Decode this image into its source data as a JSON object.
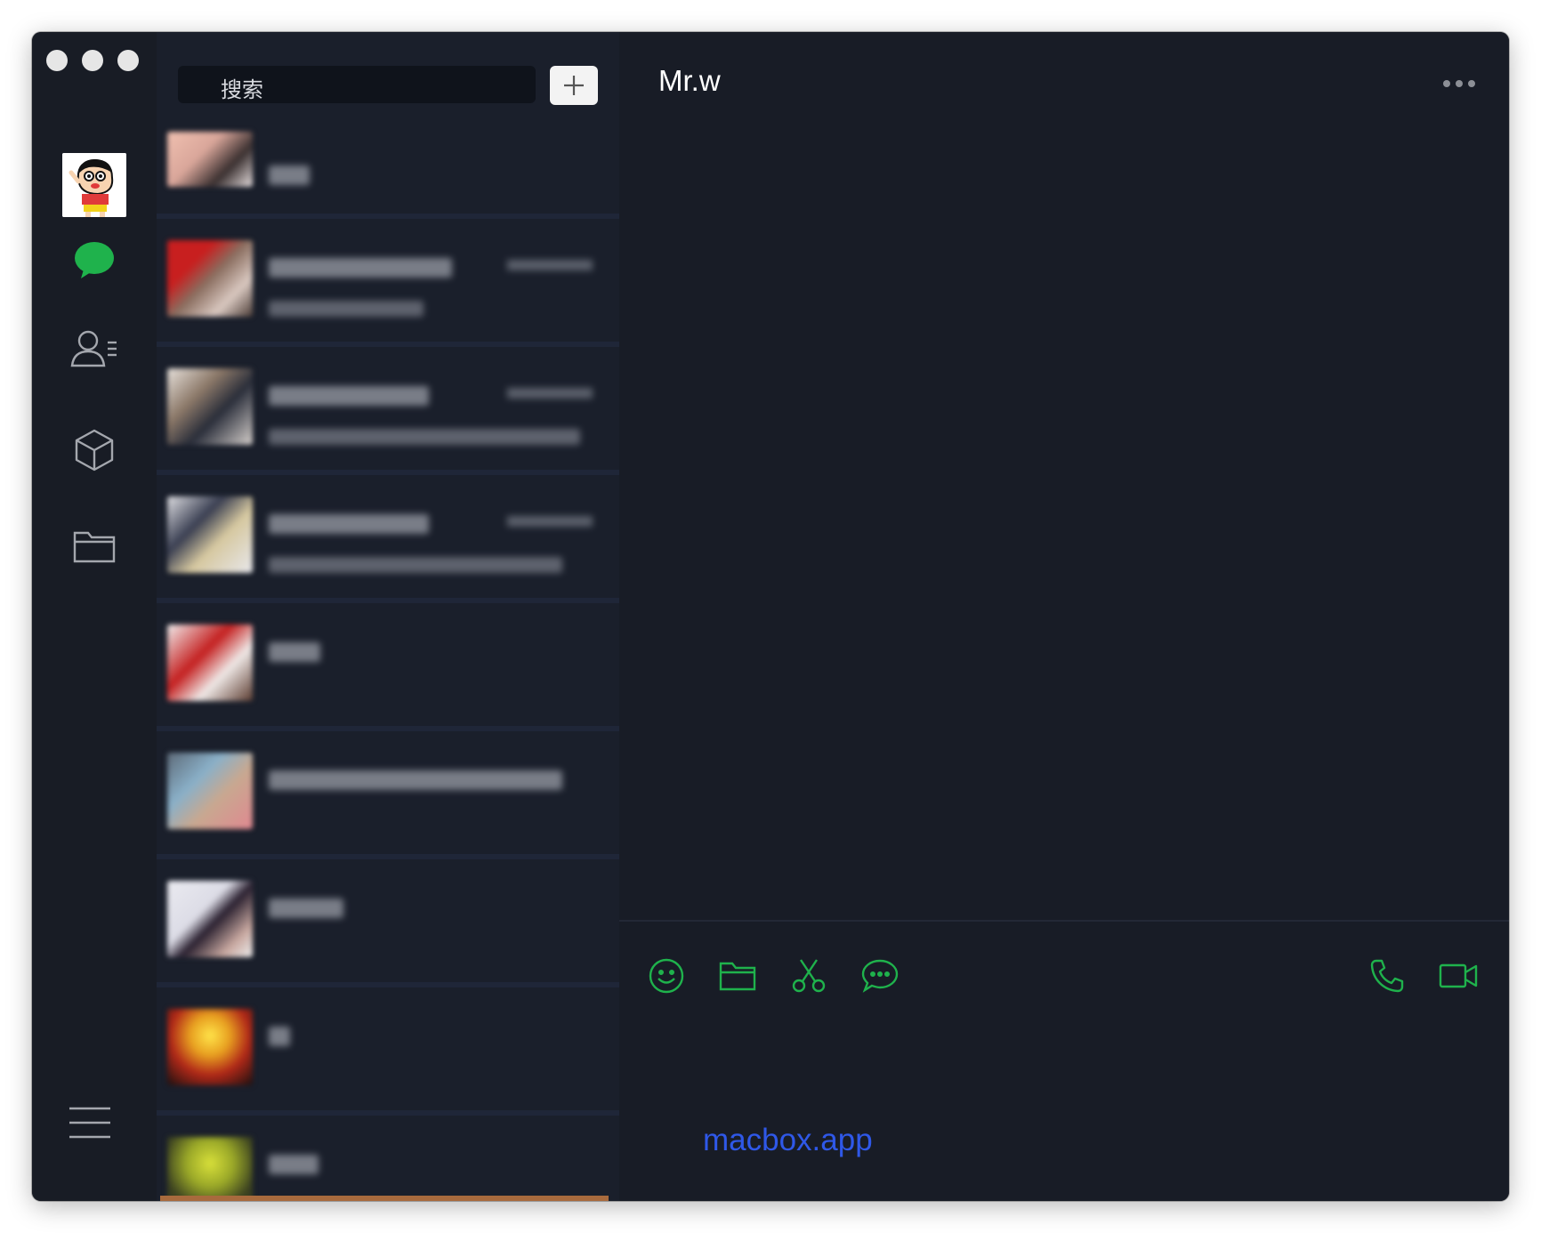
{
  "window": {
    "title": "Mr.w"
  },
  "search": {
    "placeholder": "搜索"
  },
  "chat": {
    "title": "Mr.w",
    "watermark": "macbox.app"
  },
  "nav": {
    "items": [
      {
        "name": "chats",
        "icon": "chat-bubble-icon",
        "active": true
      },
      {
        "name": "contacts",
        "icon": "contacts-icon"
      },
      {
        "name": "mini-programs",
        "icon": "cube-icon"
      },
      {
        "name": "files",
        "icon": "folder-icon"
      }
    ]
  },
  "toolbar": {
    "left": [
      "emoji-icon",
      "folder-icon",
      "scissors-icon",
      "chat-history-icon"
    ],
    "right": [
      "phone-icon",
      "video-icon"
    ]
  },
  "colors": {
    "accent": "#1fb24c",
    "background": "#191d26",
    "link": "#2f58e8"
  }
}
